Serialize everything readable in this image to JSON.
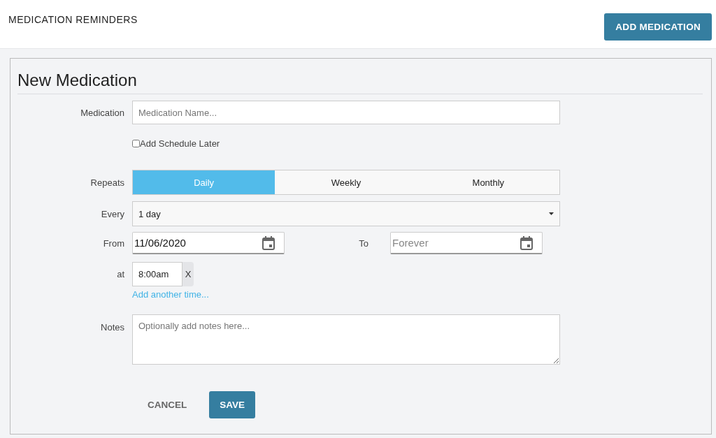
{
  "header": {
    "title": "MEDICATION REMINDERS",
    "add_button": "ADD MEDICATION"
  },
  "form": {
    "title": "New Medication",
    "medication": {
      "label": "Medication",
      "placeholder": "Medication Name..."
    },
    "schedule_later": {
      "label": "Add Schedule Later",
      "checked": false
    },
    "repeats": {
      "label": "Repeats",
      "options": [
        {
          "label": "Daily",
          "selected": true
        },
        {
          "label": "Weekly",
          "selected": false
        },
        {
          "label": "Monthly",
          "selected": false
        }
      ]
    },
    "every": {
      "label": "Every",
      "value": "1 day"
    },
    "from": {
      "label": "From",
      "value": "11/06/2020"
    },
    "to": {
      "label": "To",
      "placeholder": "Forever"
    },
    "at": {
      "label": "at",
      "times": [
        {
          "value": "8:00am",
          "remove": "X"
        }
      ],
      "add_link": "Add another time..."
    },
    "notes": {
      "label": "Notes",
      "placeholder": "Optionally add notes here..."
    },
    "buttons": {
      "cancel": "CANCEL",
      "save": "SAVE"
    }
  }
}
